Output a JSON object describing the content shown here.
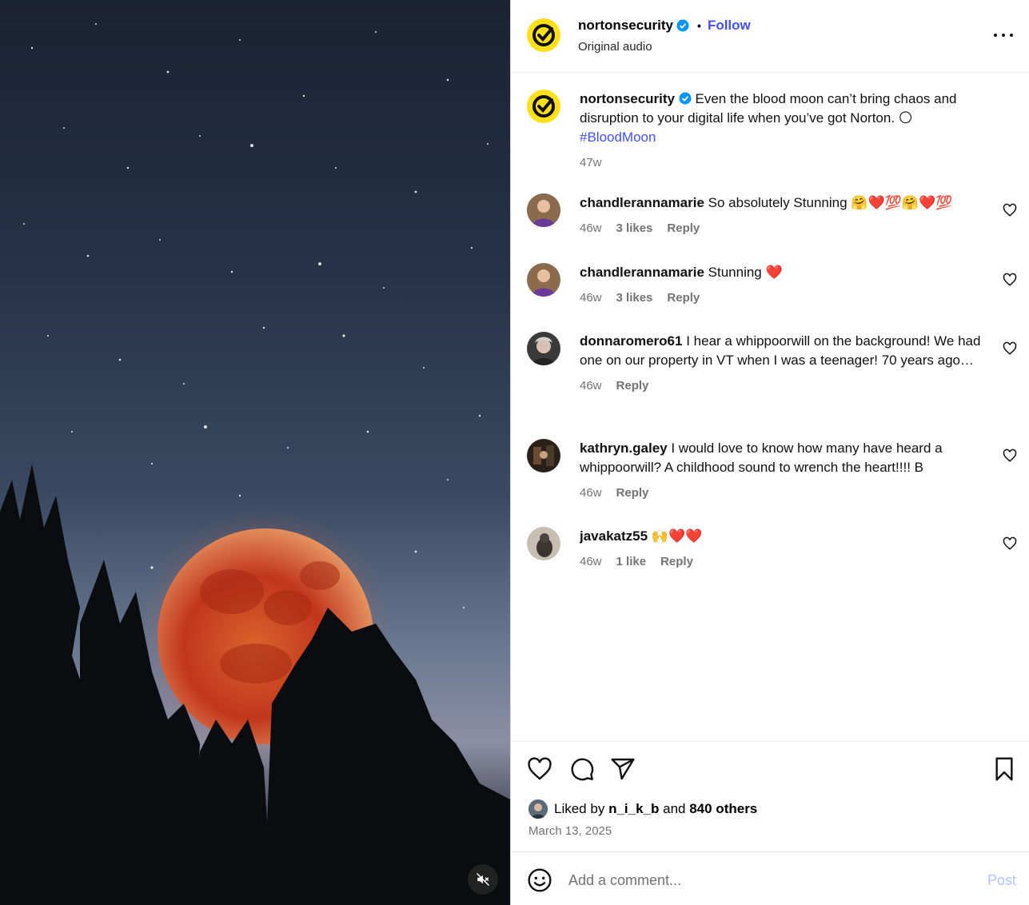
{
  "post": {
    "username": "nortonsecurity",
    "follow_label": "Follow",
    "separator": "•",
    "audio": "Original audio",
    "more_icon": "more-horizontal-icon",
    "caption_text": "Even the blood moon can’t bring chaos and disruption to your digital life when you’ve got Norton.",
    "caption_emoji": "🌕",
    "hashtag": "#BloodMoon",
    "caption_age": "47w"
  },
  "comments": [
    {
      "user": "chandlerannamarie",
      "text": "So absolutely Stunning",
      "emoji": "🤗❤️💯🤗❤️💯",
      "age": "46w",
      "likes": "3 likes",
      "reply": "Reply"
    },
    {
      "user": "chandlerannamarie",
      "text": "Stunning",
      "emoji": "❤️",
      "age": "46w",
      "likes": "3 likes",
      "reply": "Reply"
    },
    {
      "user": "donnaromero61",
      "text": "I hear a whippoorwill on the background! We had one on our property in VT when I was a teenager! 70 years ago…",
      "age": "46w",
      "reply": "Reply"
    },
    {
      "user": "kathryn.galey",
      "text": "I would love to know how many have heard a whippoorwill? A childhood sound to wrench the heart!!!! B",
      "age": "46w",
      "reply": "Reply"
    },
    {
      "user": "javakatz55",
      "emoji": "🙌❤️❤️",
      "age": "46w",
      "likes": "1 like",
      "reply": "Reply"
    }
  ],
  "actions": {
    "liked_prefix": "Liked by",
    "liked_user": "n_i_k_b",
    "liked_and": "and",
    "liked_others": "840 others",
    "date": "March 13, 2025"
  },
  "composer": {
    "placeholder": "Add a comment...",
    "post_label": "Post"
  },
  "colors": {
    "accent": "#4150f7",
    "norton_yellow": "#ffe01b",
    "verified": "#0095f6",
    "post_disabled": "#b3c6fb"
  }
}
